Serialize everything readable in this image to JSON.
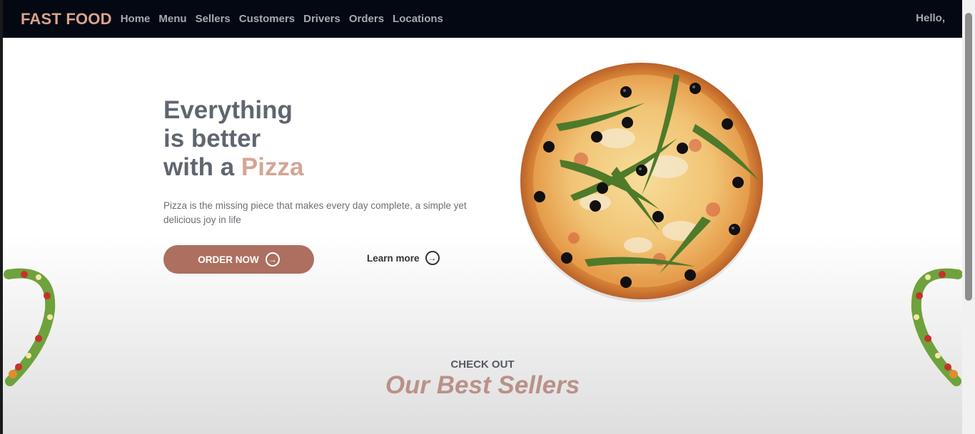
{
  "nav": {
    "brand": "FAST FOOD",
    "links": [
      "Home",
      "Menu",
      "Sellers",
      "Customers",
      "Drivers",
      "Orders",
      "Locations"
    ],
    "greeting": "Hello,"
  },
  "hero": {
    "title_line1": "Everything",
    "title_line2": "is better",
    "title_line3_prefix": "with a",
    "title_accent": "Pizza",
    "description": "Pizza is the missing piece that makes every day complete, a simple yet delicious joy in life",
    "order_button": "ORDER NOW",
    "learn_more": "Learn more",
    "button_icon": "arrow-right-circle-icon"
  },
  "section": {
    "kicker": "CHECK OUT",
    "heading": "Our Best Sellers"
  },
  "colors": {
    "navbar_bg": "#040812",
    "brand": "#d9a38e",
    "accent": "#d3a696",
    "button": "#ad6f60",
    "heading_text": "#5f6670"
  }
}
